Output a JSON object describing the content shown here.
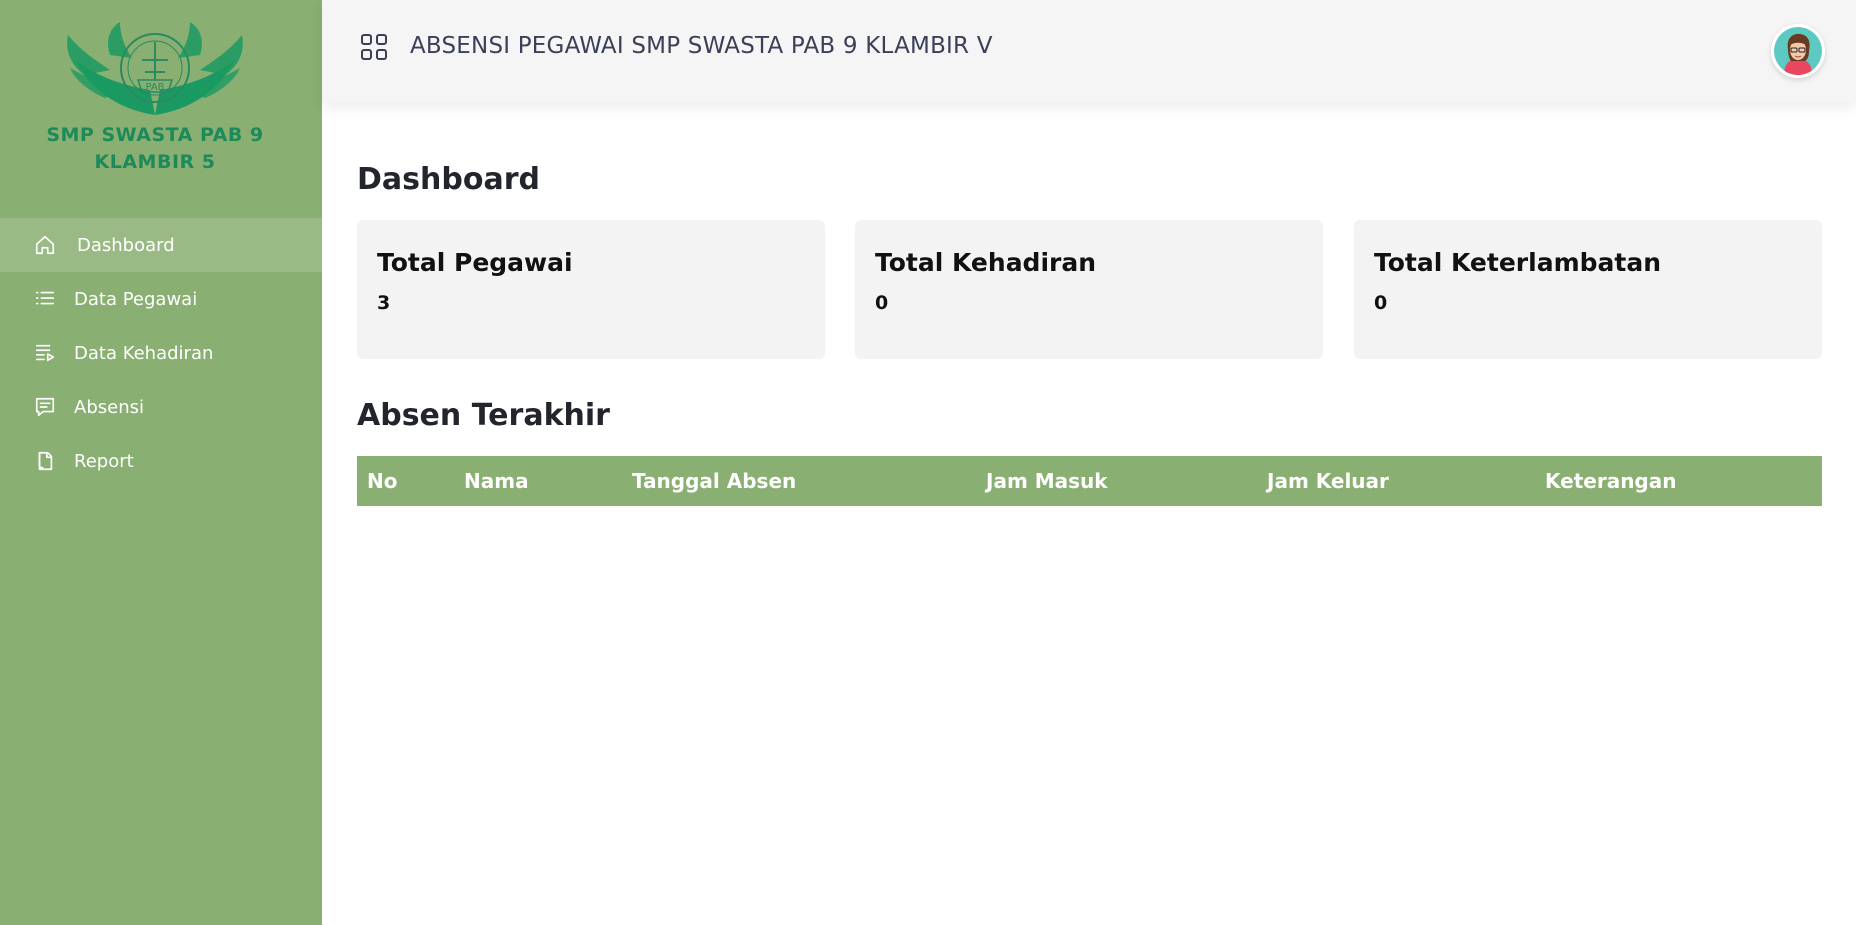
{
  "brand": {
    "logo_line1": "SMP SWASTA PAB 9",
    "logo_line2": "KLAMBIR 5",
    "logo_emblem_text": "PAB",
    "accent_color": "#8aaf72"
  },
  "sidebar": {
    "items": [
      {
        "label": "Dashboard",
        "icon": "home-icon",
        "active": true
      },
      {
        "label": "Data Pegawai",
        "icon": "list-icon",
        "active": false
      },
      {
        "label": "Data Kehadiran",
        "icon": "playlist-icon",
        "active": false
      },
      {
        "label": "Absensi",
        "icon": "message-icon",
        "active": false
      },
      {
        "label": "Report",
        "icon": "document-icon",
        "active": false
      }
    ]
  },
  "header": {
    "title": "ABSENSI PEGAWAI SMP SWASTA PAB 9 KLAMBIR V",
    "menu_icon": "grid-icon",
    "avatar_icon": "user-avatar"
  },
  "main": {
    "page_title": "Dashboard",
    "cards": [
      {
        "label": "Total Pegawai",
        "value": "3"
      },
      {
        "label": "Total Kehadiran",
        "value": "0"
      },
      {
        "label": "Total Keterlambatan",
        "value": "0"
      }
    ],
    "table_title": "Absen Terakhir",
    "table": {
      "columns": [
        "No",
        "Nama",
        "Tanggal Absen",
        "Jam Masuk",
        "Jam Keluar",
        "Keterangan"
      ],
      "rows": []
    }
  }
}
